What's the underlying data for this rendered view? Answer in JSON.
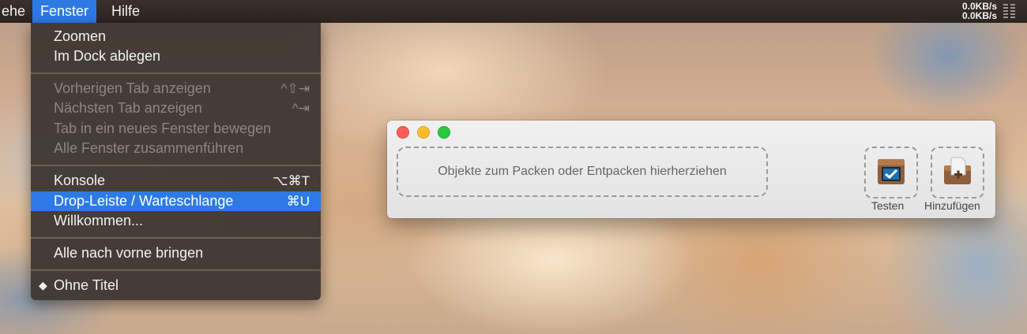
{
  "menubar": {
    "menus": [
      "ehe",
      "Fenster",
      "Hilfe"
    ],
    "network": {
      "up": "0.0KB/s",
      "down": "0.0KB/s"
    },
    "active_color": "#2d7ae5"
  },
  "dropdown": {
    "items": [
      {
        "label": "Zoomen",
        "shortcut": ""
      },
      {
        "label": "Im Dock ablegen",
        "shortcut": ""
      },
      {
        "label": "Vorherigen Tab anzeigen",
        "shortcut": "^⇧⇥"
      },
      {
        "label": "Nächsten Tab anzeigen",
        "shortcut": "^⇥"
      },
      {
        "label": "Tab in ein neues Fenster bewegen",
        "shortcut": ""
      },
      {
        "label": "Alle Fenster zusammenführen",
        "shortcut": ""
      },
      {
        "label": "Konsole",
        "shortcut": "⌥⌘T"
      },
      {
        "label": "Drop-Leiste / Warteschlange",
        "shortcut": "⌘U"
      },
      {
        "label": "Willkommen...",
        "shortcut": ""
      },
      {
        "label": "Alle nach vorne bringen",
        "shortcut": ""
      },
      {
        "label": "Ohne Titel",
        "shortcut": "",
        "marker": "◆"
      }
    ]
  },
  "window": {
    "dropzone_text": "Objekte zum Packen oder Entpacken hierherziehen",
    "tools": [
      {
        "label": "Testen",
        "icon": "archive-test-icon"
      },
      {
        "label": "Hinzufügen",
        "icon": "archive-add-icon"
      }
    ]
  }
}
